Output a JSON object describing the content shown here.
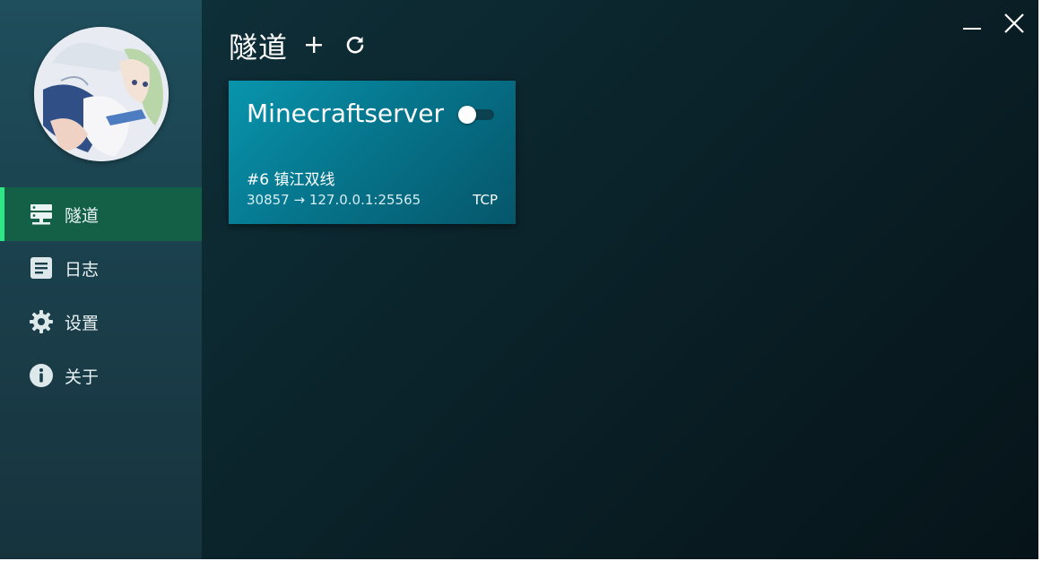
{
  "sidebar": {
    "items": [
      {
        "label": "隧道",
        "icon": "server-icon",
        "active": true
      },
      {
        "label": "日志",
        "icon": "log-icon",
        "active": false
      },
      {
        "label": "设置",
        "icon": "gear-icon",
        "active": false
      },
      {
        "label": "关于",
        "icon": "info-icon",
        "active": false
      }
    ]
  },
  "main": {
    "title": "隧道",
    "actions": [
      "add-icon",
      "refresh-icon"
    ]
  },
  "tunnels": [
    {
      "name": "Minecraftserver",
      "enabled": false,
      "node": "#6 镇江双线",
      "mapping": "30857 → 127.0.0.1:25565",
      "protocol": "TCP"
    }
  ],
  "window_controls": [
    "minimize-icon",
    "close-icon"
  ],
  "colors": {
    "active_nav": "#146046",
    "active_indicator": "#2ee888",
    "card": "#0895ad"
  }
}
